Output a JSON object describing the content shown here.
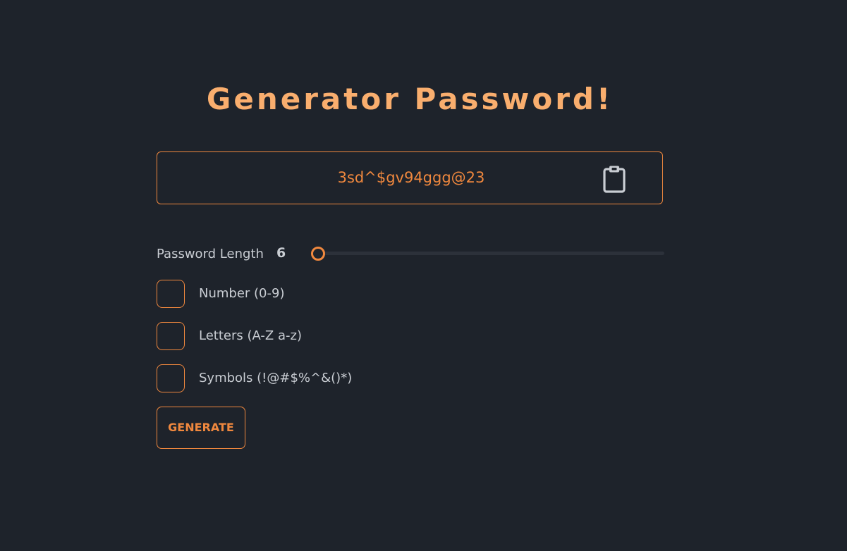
{
  "title": "Generator Password!",
  "output": {
    "password": "3sd^$gv94ggg@23",
    "copy_icon": "clipboard-icon"
  },
  "length": {
    "label": "Password Length",
    "value": "6",
    "slider_fraction": 0
  },
  "options": [
    {
      "label": "Number (0-9)",
      "checked": false
    },
    {
      "label": "Letters (A-Z a-z)",
      "checked": false
    },
    {
      "label": "Symbols (!@#$%^&()*)",
      "checked": false
    }
  ],
  "generate_label": "GENERATE",
  "colors": {
    "background": "#1e232b",
    "accent": "#f0883e",
    "title": "#f9ae6e",
    "text": "#c9cdd3"
  }
}
